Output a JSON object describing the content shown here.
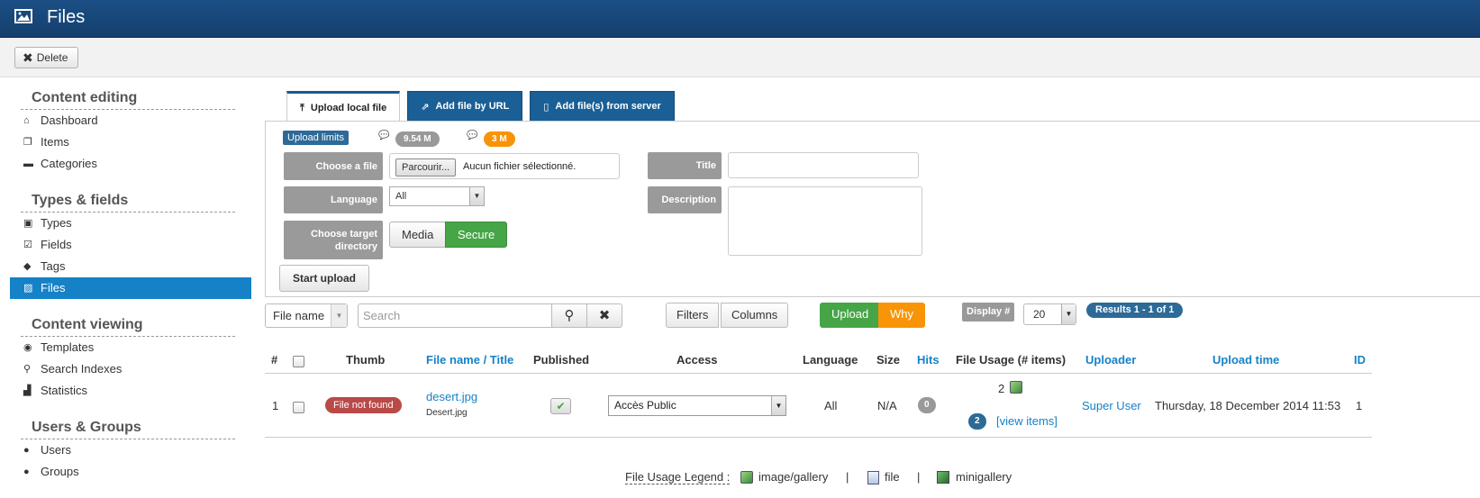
{
  "header": {
    "title": "Files"
  },
  "toolbar": {
    "delete_label": "Delete"
  },
  "sidebar": {
    "sections": [
      {
        "title": "Content editing",
        "items": [
          {
            "label": "Dashboard",
            "icon": "home-icon"
          },
          {
            "label": "Items",
            "icon": "copy-icon"
          },
          {
            "label": "Categories",
            "icon": "folder-icon"
          }
        ]
      },
      {
        "title": "Types & fields",
        "items": [
          {
            "label": "Types",
            "icon": "briefcase-icon"
          },
          {
            "label": "Fields",
            "icon": "checklist-icon"
          },
          {
            "label": "Tags",
            "icon": "tags-icon"
          },
          {
            "label": "Files",
            "icon": "image-icon",
            "active": true
          }
        ]
      },
      {
        "title": "Content viewing",
        "items": [
          {
            "label": "Templates",
            "icon": "eye-icon"
          },
          {
            "label": "Search Indexes",
            "icon": "search-icon"
          },
          {
            "label": "Statistics",
            "icon": "chart-icon"
          }
        ]
      },
      {
        "title": "Users & Groups",
        "items": [
          {
            "label": "Users",
            "icon": "user-icon"
          },
          {
            "label": "Groups",
            "icon": "users-icon"
          }
        ]
      }
    ]
  },
  "tabs": [
    {
      "label": "Upload local file",
      "icon": "upload-icon",
      "active": true
    },
    {
      "label": "Add file by URL",
      "icon": "share-icon",
      "active": false
    },
    {
      "label": "Add file(s) from server",
      "icon": "file-icon",
      "active": false
    }
  ],
  "upload": {
    "limits_label": "Upload limits",
    "limit_1": "9.54 M",
    "limit_2": "3 M",
    "choose_file_label": "Choose a file",
    "browse_label": "Parcourir...",
    "no_file_text": "Aucun fichier sélectionné.",
    "language_label": "Language",
    "language_value": "All",
    "target_dir_label": "Choose target directory",
    "dir_media": "Media",
    "dir_secure": "Secure",
    "start_upload": "Start upload",
    "title_label": "Title",
    "description_label": "Description"
  },
  "filters": {
    "field_select": "File name",
    "search_placeholder": "Search",
    "filters_btn": "Filters",
    "columns_btn": "Columns",
    "upload_btn": "Upload",
    "why_btn": "Why",
    "display_label": "Display #",
    "display_value": "20",
    "results": "Results 1 - 1 of 1"
  },
  "table": {
    "headers": {
      "num": "#",
      "thumb": "Thumb",
      "filename": "File name / Title",
      "published": "Published",
      "access": "Access",
      "language": "Language",
      "size": "Size",
      "hits": "Hits",
      "usage": "File Usage (# items)",
      "uploader": "Uploader",
      "upload_time": "Upload time",
      "id": "ID"
    },
    "rows": [
      {
        "num": "1",
        "thumb_status": "File not found",
        "filename": "desert.jpg",
        "title": "Desert.jpg",
        "access": "Accès Public",
        "language": "All",
        "size": "N/A",
        "hits": "0",
        "usage_count": "2",
        "usage_items_badge": "2",
        "view_items": "[view items]",
        "uploader": "Super User",
        "upload_time": "Thursday, 18 December 2014 11:53",
        "id": "1"
      }
    ]
  },
  "legend": {
    "title": "File Usage Legend :",
    "gallery": "image/gallery",
    "sep": "|",
    "file": "file",
    "minigallery": "minigallery"
  },
  "colors": {
    "header": "#1b4f85",
    "accent": "#1582c8",
    "success": "#46a546",
    "warning": "#f89406",
    "danger": "#b94a48"
  }
}
